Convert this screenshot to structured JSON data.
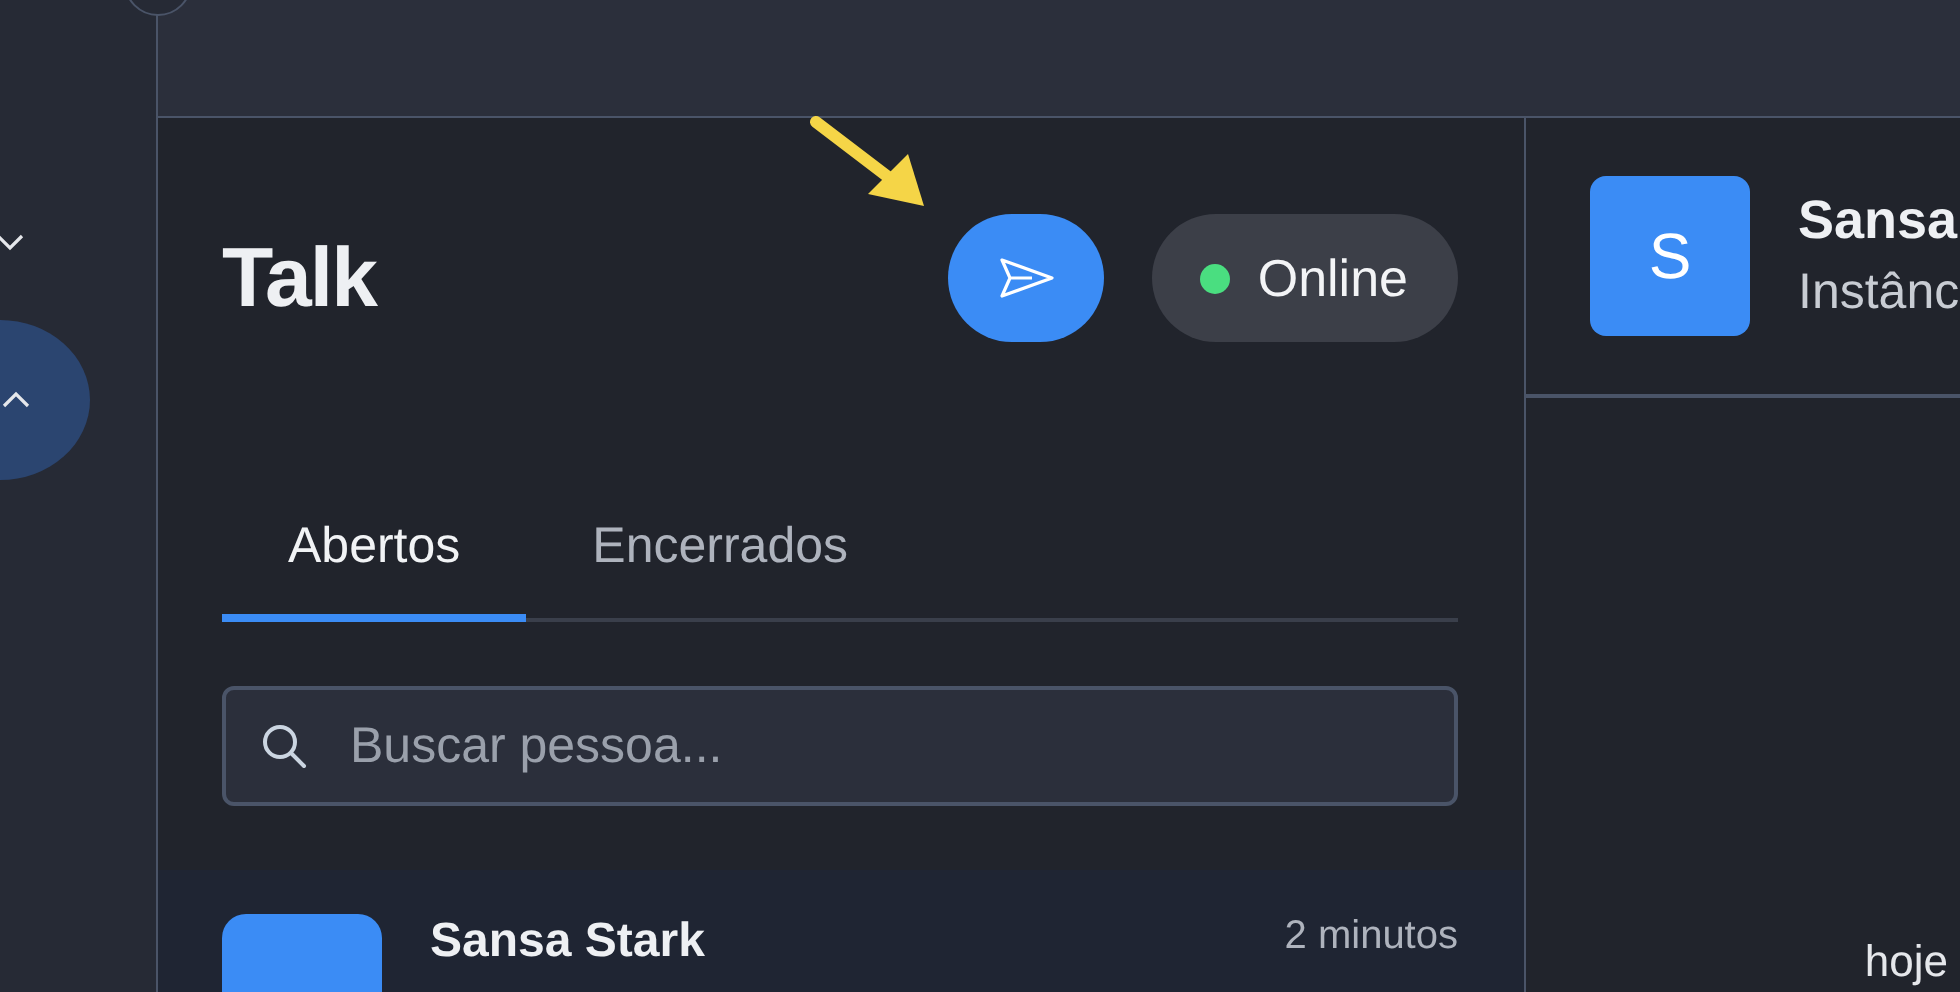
{
  "sidebar": {
    "items": [
      {
        "kind": "collapse",
        "selected": false
      },
      {
        "kind": "expand",
        "selected": true
      }
    ]
  },
  "panel": {
    "title": "Talk",
    "send_button": {
      "annotated": true
    },
    "status": {
      "label": "Online",
      "color": "#4ade80"
    },
    "tabs": [
      {
        "label": "Abertos",
        "selected": true
      },
      {
        "label": "Encerrados",
        "selected": false
      }
    ],
    "search": {
      "placeholder": "Buscar pessoa..."
    },
    "conversations": [
      {
        "name": "Sansa Stark",
        "time": "2 minutos"
      }
    ]
  },
  "chat": {
    "avatar": "S",
    "name": "Sansa",
    "subtitle": "Instânc",
    "last_time": "hoje"
  }
}
